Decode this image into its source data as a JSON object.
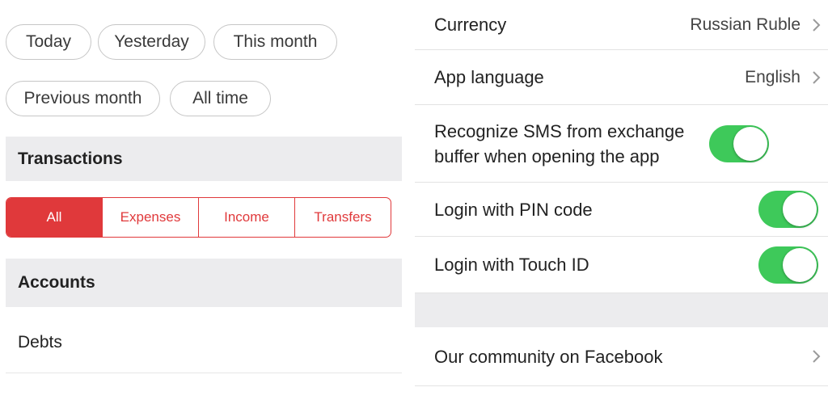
{
  "periods": {
    "today": "Today",
    "yesterday": "Yesterday",
    "this_month": "This month",
    "previous_month": "Previous month",
    "all_time": "All time"
  },
  "transactions": {
    "header": "Transactions",
    "segments": [
      "All",
      "Expenses",
      "Income",
      "Transfers"
    ],
    "selected": "All"
  },
  "accounts": {
    "header": "Accounts"
  },
  "debts": {
    "label": "Debts"
  },
  "settings": {
    "currency": {
      "label": "Currency",
      "value": "Russian Ruble"
    },
    "language": {
      "label": "App language",
      "value": "English"
    },
    "sms": {
      "label": "Recognize SMS from exchange buffer when opening the app",
      "on": true
    },
    "pin": {
      "label": "Login with PIN code",
      "on": true
    },
    "touch_id": {
      "label": "Login with Touch ID",
      "on": true
    },
    "facebook": {
      "label": "Our community on Facebook"
    }
  },
  "colors": {
    "accent_red": "#e0393b",
    "toggle_green": "#3ec95a",
    "section_gray": "#ececee"
  },
  "icons": [
    "chevron-right-icon"
  ]
}
